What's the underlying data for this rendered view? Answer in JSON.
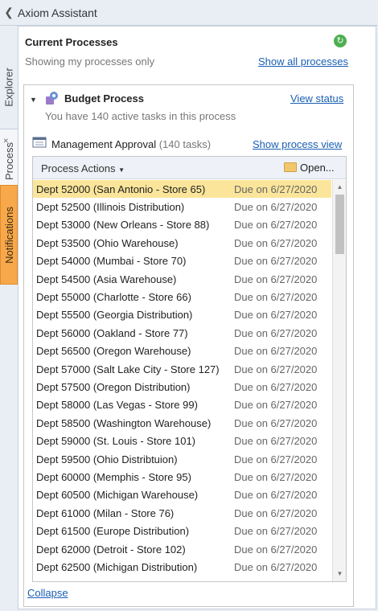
{
  "window": {
    "title": "Axiom Assistant",
    "back_icon": "chevron-left-icon"
  },
  "side_tabs": [
    {
      "label": "Explorer"
    },
    {
      "label": "Process",
      "close": "×"
    },
    {
      "label": "Notifications"
    }
  ],
  "current_processes": {
    "title": "Current Processes",
    "subtitle": "Showing my processes only",
    "show_all_link": "Show all processes",
    "refresh_icon": "refresh-icon"
  },
  "budget_process": {
    "title": "Budget Process",
    "active_tasks_text": "You have 140 active tasks in this process",
    "view_status_link": "View status"
  },
  "step": {
    "title": "Management Approval",
    "count": "(140 tasks)",
    "show_view_link": "Show process view"
  },
  "toolbar": {
    "actions_label": "Process Actions",
    "open_label": "Open..."
  },
  "tasks": [
    {
      "name": "Dept 52000 (San Antonio - Store 65)",
      "due": "Due on 6/27/2020"
    },
    {
      "name": "Dept 52500 (Illinois Distribution)",
      "due": "Due on 6/27/2020"
    },
    {
      "name": "Dept 53000 (New Orleans - Store 88)",
      "due": "Due on 6/27/2020"
    },
    {
      "name": "Dept 53500 (Ohio Warehouse)",
      "due": "Due on 6/27/2020"
    },
    {
      "name": "Dept 54000 (Mumbai - Store 70)",
      "due": "Due on 6/27/2020"
    },
    {
      "name": "Dept 54500 (Asia Warehouse)",
      "due": "Due on 6/27/2020"
    },
    {
      "name": "Dept 55000 (Charlotte - Store 66)",
      "due": "Due on 6/27/2020"
    },
    {
      "name": "Dept 55500 (Georgia Distribution)",
      "due": "Due on 6/27/2020"
    },
    {
      "name": "Dept 56000 (Oakland - Store 77)",
      "due": "Due on 6/27/2020"
    },
    {
      "name": "Dept 56500 (Oregon Warehouse)",
      "due": "Due on 6/27/2020"
    },
    {
      "name": "Dept 57000 (Salt Lake City - Store 127)",
      "due": "Due on 6/27/2020"
    },
    {
      "name": "Dept 57500 (Oregon Distribution)",
      "due": "Due on 6/27/2020"
    },
    {
      "name": "Dept 58000 (Las Vegas - Store 99)",
      "due": "Due on 6/27/2020"
    },
    {
      "name": "Dept 58500 (Washington Warehouse)",
      "due": "Due on 6/27/2020"
    },
    {
      "name": "Dept 59000 (St. Louis - Store 101)",
      "due": "Due on 6/27/2020"
    },
    {
      "name": "Dept 59500 (Ohio Distribtuion)",
      "due": "Due on 6/27/2020"
    },
    {
      "name": "Dept 60000 (Memphis - Store 95)",
      "due": "Due on 6/27/2020"
    },
    {
      "name": "Dept 60500 (Michigan Warehouse)",
      "due": "Due on 6/27/2020"
    },
    {
      "name": "Dept 61000 (Milan - Store 76)",
      "due": "Due on 6/27/2020"
    },
    {
      "name": "Dept 61500 (Europe Distribution)",
      "due": "Due on 6/27/2020"
    },
    {
      "name": "Dept 62000 (Detroit - Store 102)",
      "due": "Due on 6/27/2020"
    },
    {
      "name": "Dept 62500 (Michigan Distribution)",
      "due": "Due on 6/27/2020"
    }
  ],
  "selected_index": 0,
  "collapse_link": "Collapse",
  "colors": {
    "selection": "#fbe59a",
    "link": "#1a5fb4",
    "notifications_tab": "#f7a84b"
  }
}
